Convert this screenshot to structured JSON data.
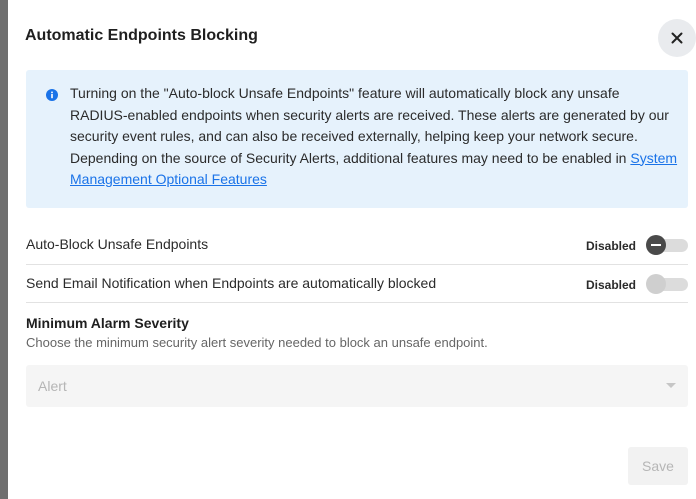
{
  "dialog": {
    "title": "Automatic Endpoints Blocking",
    "close_icon": "close-icon"
  },
  "info": {
    "icon": "info-circle-icon",
    "text": "Turning on the \"Auto-block Unsafe Endpoints\" feature will automatically block any unsafe RADIUS-enabled endpoints when security alerts are received. These alerts are generated by our security event rules, and can also be received externally, helping keep your network secure. Depending on the source of Security Alerts, additional features may need to be enabled in ",
    "link_text": "System Management Optional Features"
  },
  "settings": {
    "auto_block": {
      "label": "Auto-Block Unsafe Endpoints",
      "status": "Disabled",
      "enabled": false
    },
    "email_notification": {
      "label": "Send Email Notification when Endpoints are automatically blocked",
      "status": "Disabled",
      "enabled": false,
      "toggle_disabled": true
    }
  },
  "severity": {
    "title": "Minimum Alarm Severity",
    "description": "Choose the minimum security alert severity needed to block an unsafe endpoint.",
    "selected": "Alert"
  },
  "footer": {
    "save_label": "Save"
  },
  "colors": {
    "info_bg": "#e6f2fc",
    "info_icon": "#1a73e8",
    "link": "#1a73e8",
    "toggle_thumb": "#4a4a4a"
  }
}
